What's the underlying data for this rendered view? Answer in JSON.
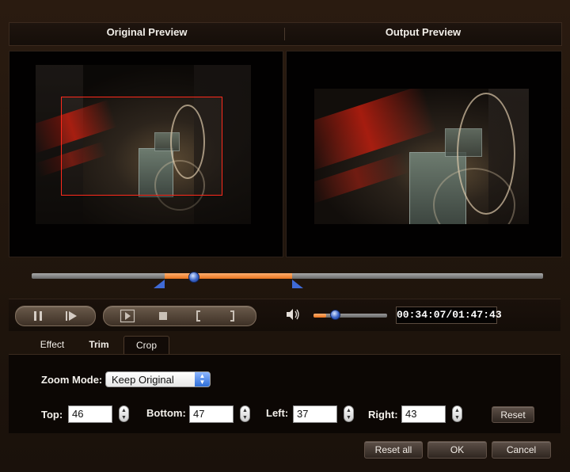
{
  "header": {
    "original_preview": "Original Preview",
    "output_preview": "Output Preview"
  },
  "playback": {
    "time": "00:34:07/01:47:43",
    "position_fraction": 0.317,
    "trim_start_fraction": 0.26,
    "trim_end_fraction": 0.51,
    "volume_fraction": 0.17
  },
  "tabs": [
    {
      "label": "Effect"
    },
    {
      "label": "Trim"
    },
    {
      "label": "Crop"
    }
  ],
  "active_tab": "Crop",
  "crop": {
    "zoom_mode_label": "Zoom Mode:",
    "zoom_mode_value": "Keep Original",
    "top_label": "Top:",
    "top_value": "46",
    "bottom_label": "Bottom:",
    "bottom_value": "47",
    "left_label": "Left:",
    "left_value": "37",
    "right_label": "Right:",
    "right_value": "43",
    "reset_label": "Reset"
  },
  "footer": {
    "reset_all": "Reset all",
    "ok": "OK",
    "cancel": "Cancel"
  },
  "colors": {
    "accent_orange": "#e8731e",
    "crop_red": "#ff2a1c",
    "knob_blue": "#3b64c6"
  },
  "icons": {
    "pause": "pause-icon",
    "next_frame": "next-frame-icon",
    "step": "step-icon",
    "stop": "stop-icon",
    "mark_in": "mark-in-icon",
    "mark_out": "mark-out-icon",
    "volume": "speaker-icon"
  }
}
